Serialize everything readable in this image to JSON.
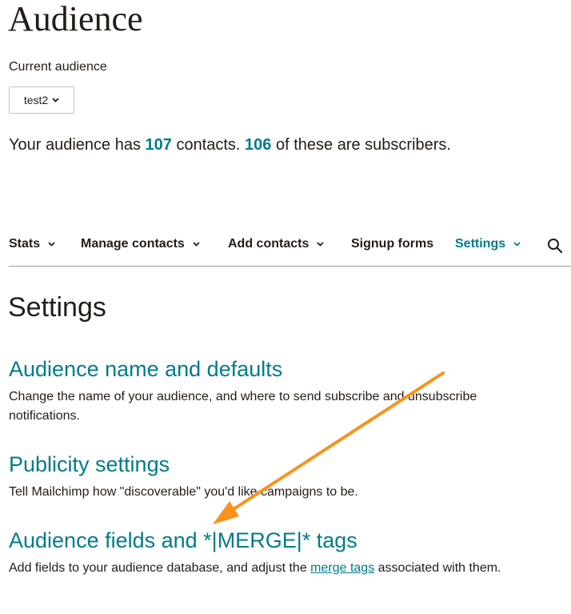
{
  "header": {
    "title": "Audience",
    "current_label": "Current audience"
  },
  "audience_select": {
    "value": "test2",
    "icon": "chevron-down-icon"
  },
  "summary": {
    "prefix": "Your audience has ",
    "contacts": "107",
    "middle": " contacts. ",
    "subscribers": "106",
    "suffix": " of these are subscribers."
  },
  "nav": {
    "items": [
      {
        "label": "Stats",
        "has_dropdown": true,
        "active": false
      },
      {
        "label": "Manage contacts",
        "has_dropdown": true,
        "active": false
      },
      {
        "label": "Add contacts",
        "has_dropdown": true,
        "active": false
      },
      {
        "label": "Signup forms",
        "has_dropdown": false,
        "active": false
      },
      {
        "label": "Settings",
        "has_dropdown": true,
        "active": true
      }
    ],
    "search_icon": "search-icon"
  },
  "settings": {
    "title": "Settings",
    "sections": [
      {
        "title": "Audience name and defaults",
        "desc": "Change the name of your audience, and where to send subscribe and unsubscribe notifications."
      },
      {
        "title": "Publicity settings",
        "desc": "Tell Mailchimp how \"discoverable\" you'd like campaigns to be."
      },
      {
        "title": "Audience fields and *|MERGE|* tags",
        "desc_prefix": "Add fields to your audience database, and adjust the ",
        "desc_link": "merge tags",
        "desc_suffix": " associated with them."
      }
    ]
  },
  "annotation": {
    "icon": "orange-arrow-annotation",
    "color": "#f7941d"
  },
  "colors": {
    "accent": "#007c89",
    "text": "#241c15",
    "divider": "#9c9c9c"
  }
}
